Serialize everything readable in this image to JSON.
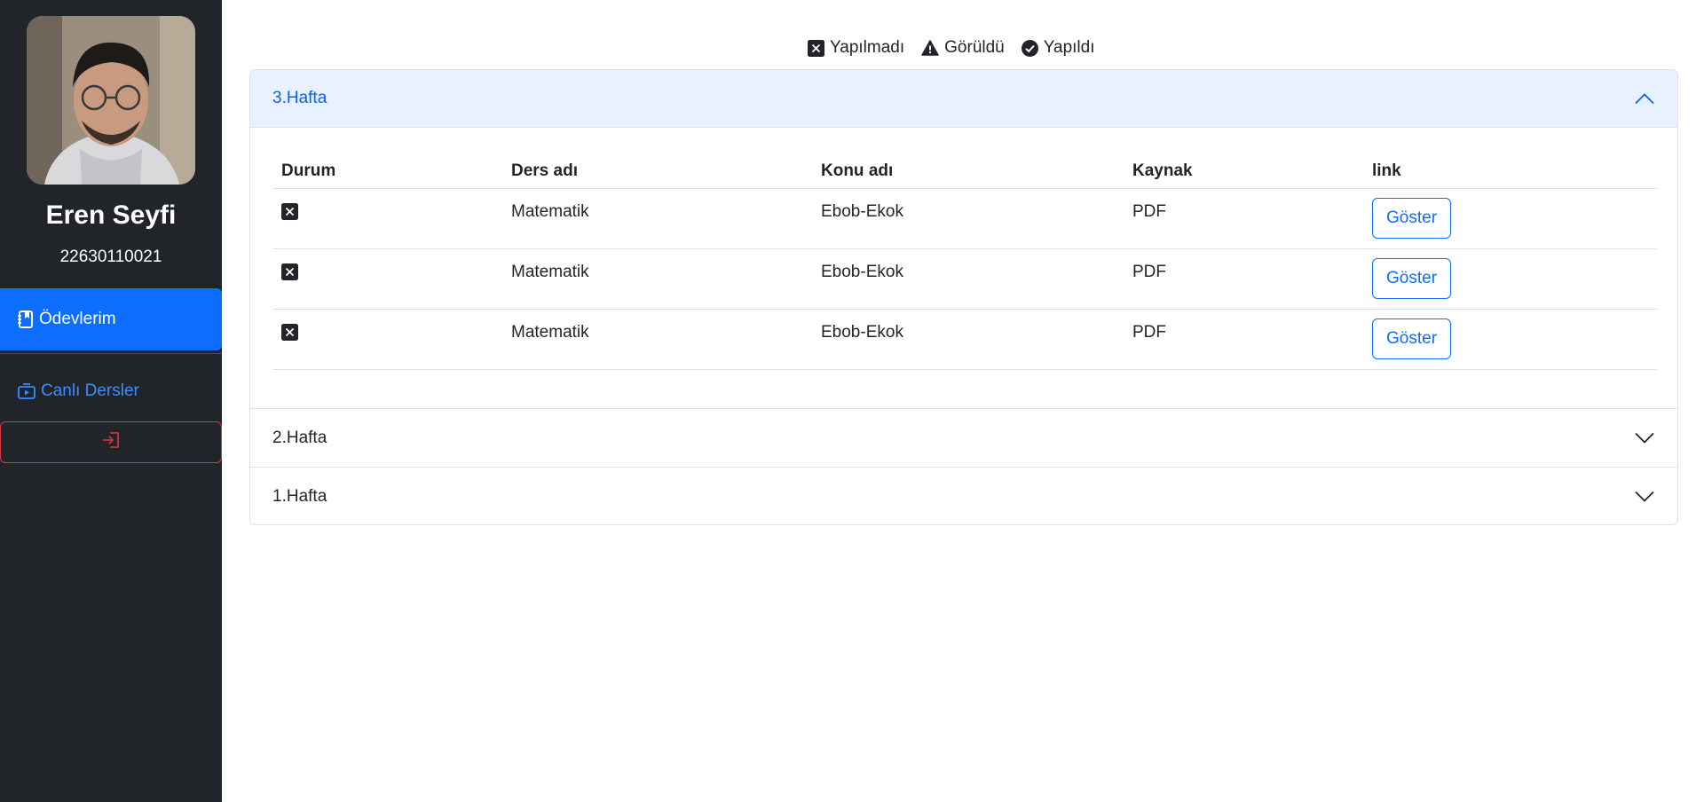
{
  "sidebar": {
    "user_name": "Eren Seyfi",
    "user_id": "22630110021",
    "nav_items": [
      {
        "label": "Ödevlerim",
        "icon": "journal-bookmark-icon",
        "active": true
      },
      {
        "label": "Canlı Dersler",
        "icon": "camera-video-icon",
        "active": false
      }
    ],
    "logout_icon": "box-arrow-in-right-icon"
  },
  "legend": {
    "items": [
      {
        "label": "Yapılmadı",
        "icon": "x-square-fill-icon"
      },
      {
        "label": "Görüldü",
        "icon": "exclamation-triangle-fill-icon"
      },
      {
        "label": "Yapıldı",
        "icon": "check-circle-fill-icon"
      }
    ]
  },
  "weeks": [
    {
      "title": "3.Hafta",
      "expanded": true,
      "table": {
        "headers": [
          "Durum",
          "Ders adı",
          "Konu adı",
          "Kaynak",
          "link"
        ],
        "rows": [
          {
            "status": "Yapılmadı",
            "course": "Matematik",
            "topic": "Ebob-Ekok",
            "source": "PDF",
            "button": "Göster"
          },
          {
            "status": "Yapılmadı",
            "course": "Matematik",
            "topic": "Ebob-Ekok",
            "source": "PDF",
            "button": "Göster"
          },
          {
            "status": "Yapılmadı",
            "course": "Matematik",
            "topic": "Ebob-Ekok",
            "source": "PDF",
            "button": "Göster"
          }
        ]
      }
    },
    {
      "title": "2.Hafta",
      "expanded": false
    },
    {
      "title": "1.Hafta",
      "expanded": false
    }
  ],
  "colors": {
    "sidebar_bg": "#212529",
    "primary": "#0d6efd",
    "danger": "#dc3545",
    "accordion_open_bg": "#e7f1ff"
  }
}
